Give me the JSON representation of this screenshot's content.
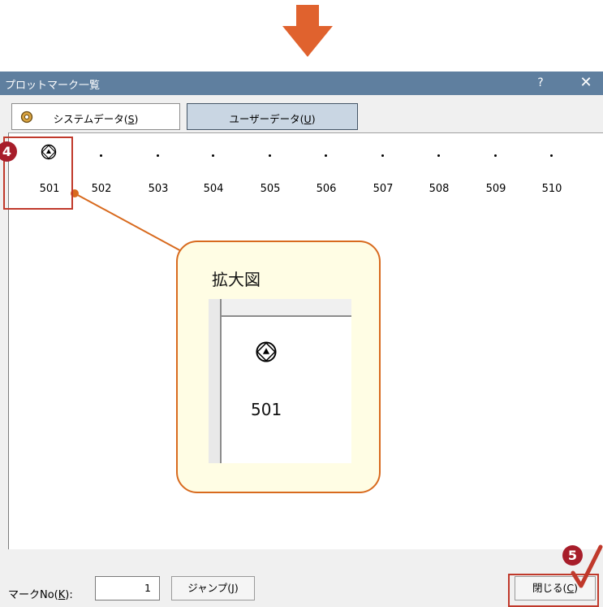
{
  "window": {
    "title": "プロットマーク一覧",
    "help": "?",
    "close": "✕"
  },
  "tabs": {
    "system": {
      "pre": "システムデータ(",
      "key": "S",
      "post": ")"
    },
    "user": {
      "pre": "ユーザーデータ(",
      "key": "U",
      "post": ")"
    }
  },
  "marks": [
    "501",
    "502",
    "503",
    "504",
    "505",
    "506",
    "507",
    "508",
    "509",
    "510"
  ],
  "bottom": {
    "markno_pre": "マークNo(",
    "markno_key": "K",
    "markno_post": "):",
    "markno_value": "1",
    "jump_pre": "ジャンプ(",
    "jump_key": "J",
    "jump_post": ")",
    "close_pre": "閉じる(",
    "close_key": "C",
    "close_post": ")"
  },
  "annotations": {
    "badge_4": "4",
    "badge_5": "5",
    "callout_title": "拡大図",
    "callout_mark": "501"
  },
  "colors": {
    "arrow": "#e0622e",
    "annotation_red": "#c0392b",
    "callout_border": "#d86a1e",
    "callout_bg": "#fffde4",
    "titlebar": "#5f7f9f"
  },
  "icons": {
    "arrow": "arrow-down-icon",
    "system_tab": "system-data-icon",
    "mark_symbol": "plot-mark-symbol-icon",
    "check": "checkmark-icon"
  }
}
